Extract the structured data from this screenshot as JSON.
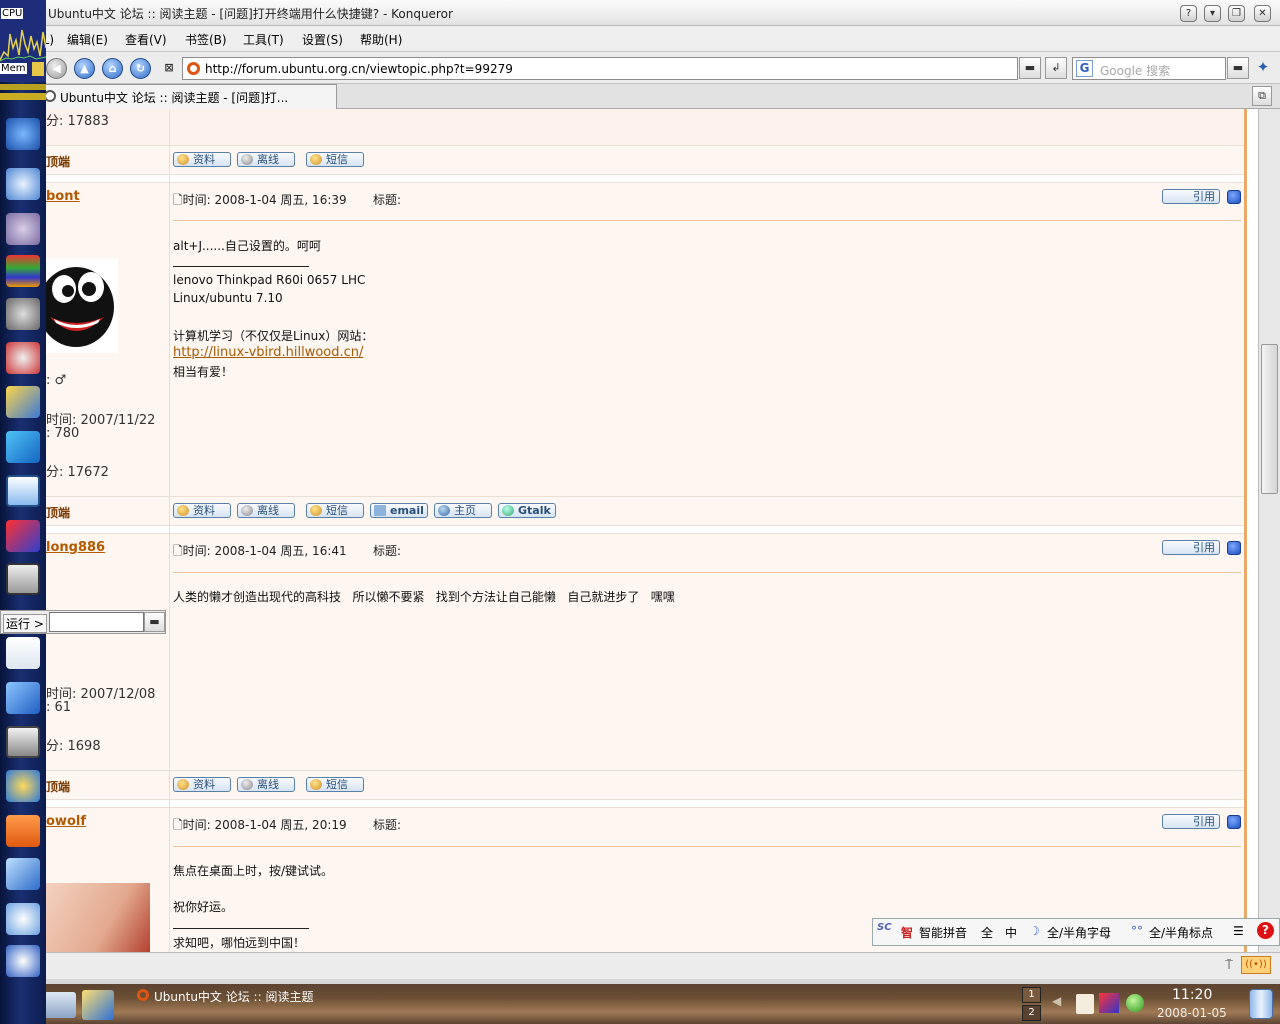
{
  "window": {
    "title": "Ubuntu中文 论坛 :: 阅读主题 - [问题]打开终端用什么快捷键? - Konqueror"
  },
  "menu": {
    "items": [
      "位置(L)",
      "编辑(E)",
      "查看(V)",
      "书签(B)",
      "工具(T)",
      "设置(S)",
      "帮助(H)"
    ]
  },
  "toolbar": {
    "url": "http://forum.ubuntu.org.cn/viewtopic.php?t=99279",
    "search_placeholder": "Google 搜索"
  },
  "tab": {
    "label": "Ubuntu中文 论坛 :: 阅读主题 - [问题]打..."
  },
  "sysmon": {
    "cpu_label": "CPU",
    "mem_label": "Mem"
  },
  "run": {
    "label": "运行 >"
  },
  "posts": [
    {
      "username": "",
      "user_info": [
        "分: 17883"
      ],
      "to_top": "顶端",
      "buttons": [
        "资料",
        "离线",
        "短信"
      ]
    },
    {
      "username": "bont",
      "user_info": [
        ": ♂",
        "时间: 2007/11/22",
        ": 780",
        "分: 17672"
      ],
      "time": "时间: 2008-1-04 周五, 16:39",
      "subject_label": "标题:",
      "quote": "引用",
      "body": [
        "alt+J......自己设置的。呵呵"
      ],
      "signature": [
        "lenovo Thinkpad R60i 0657 LHC",
        "Linux/ubuntu 7.10",
        "",
        "计算机学习（不仅仅是Linux）网站：",
        "http://linux-vbird.hillwood.cn/",
        "相当有爱！"
      ],
      "to_top": "顶端",
      "buttons": [
        "资料",
        "离线",
        "短信",
        "email",
        "主页",
        "Gtalk"
      ]
    },
    {
      "username": "long886",
      "user_info": [
        "时间: 2007/12/08",
        ": 61",
        "分: 1698"
      ],
      "time": "时间: 2008-1-04 周五, 16:41",
      "subject_label": "标题:",
      "quote": "引用",
      "body": [
        "人类的懒才创造出现代的高科技   所以懒不要紧   找到个方法让自己能懒   自己就进步了   嘿嘿"
      ],
      "to_top": "顶端",
      "buttons": [
        "资料",
        "离线",
        "短信"
      ]
    },
    {
      "username": "owolf",
      "time": "时间: 2008-1-04 周五, 20:19",
      "subject_label": "标题:",
      "quote": "引用",
      "body": [
        "焦点在桌面上时，按/键试试。",
        "祝你好运。"
      ],
      "signature": [
        "求知吧，哪怕远到中国！"
      ]
    }
  ],
  "ime": {
    "mode": "智能拼音",
    "full": "全",
    "chinese": "中",
    "letter": "全/半角字母",
    "punct": "全/半角标点"
  },
  "taskbar": {
    "task_label": "Ubuntu中文 论坛 :: 阅读主题",
    "desktop_1": "1",
    "desktop_2": "2",
    "clock_time": "11:20",
    "clock_date": "2008-01-05"
  }
}
